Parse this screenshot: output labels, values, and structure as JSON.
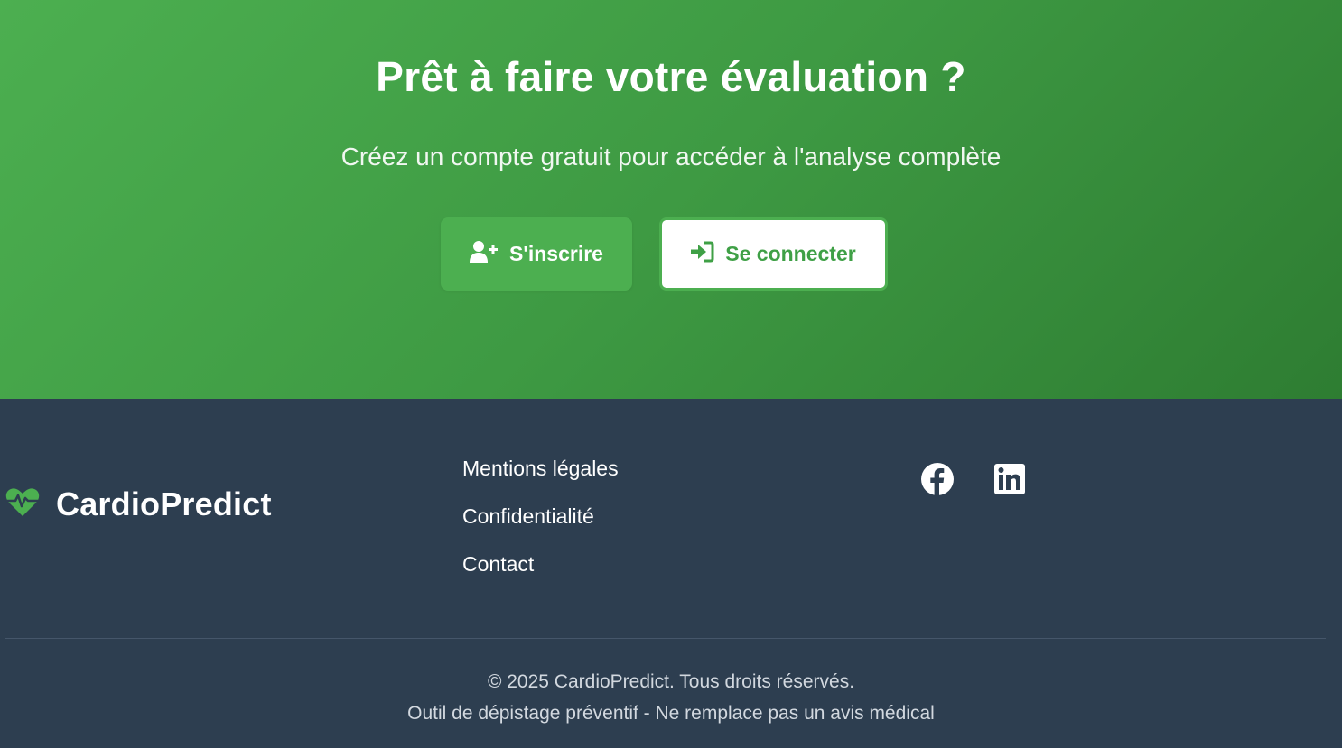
{
  "cta": {
    "title": "Prêt à faire votre évaluation ?",
    "subtitle": "Créez un compte gratuit pour accéder à l'analyse complète",
    "register_label": "S'inscrire",
    "login_label": "Se connecter"
  },
  "footer": {
    "brand": "CardioPredict",
    "links": [
      "Mentions légales",
      "Confidentialité",
      "Contact"
    ],
    "social": [
      "facebook-icon",
      "linkedin-icon"
    ],
    "copyright": "© 2025 CardioPredict. Tous droits réservés.",
    "disclaimer": "Outil de dépistage préventif - Ne remplace pas un avis médical"
  },
  "colors": {
    "primary_green": "#4caf50",
    "dark_green": "#2e7d32",
    "footer_bg": "#2d3e50"
  }
}
